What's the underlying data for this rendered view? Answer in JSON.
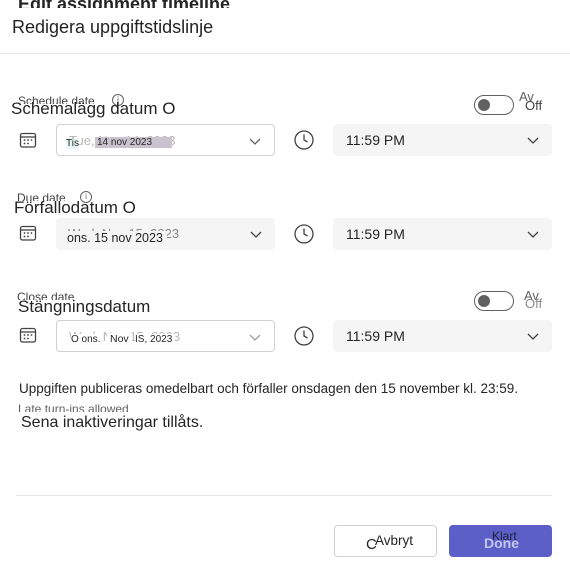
{
  "dialog": {
    "title": "Redigera uppgiftstidslinje",
    "title_ghost": "Edit assignment timeline"
  },
  "schedule": {
    "label": "Schemalägg datum O",
    "label_ghost": "Schedule date",
    "toggle_on_label": "Av",
    "toggle_off_label": "Off",
    "date_ghost": "Tue, Nov 14, 2023",
    "date_day": "Tis",
    "date_value": "14 nov 2023",
    "time": "11:59 PM"
  },
  "due": {
    "label": "Förfallodatum O",
    "label_ghost": "Due date",
    "date_ghost": "Wed, Nov 15, 2023",
    "date_value": "ons. 15 nov 2023",
    "time": "11:59 PM"
  },
  "close": {
    "label": "Stängningsdatum",
    "label_ghost": "Close date",
    "toggle_on_label": "Av",
    "toggle_off_label": "Off",
    "date_ghost": "Wed, Nov 15, 2023",
    "date_part1": "O ons.",
    "date_part2": "Nov",
    "date_part3": "IS, 2023",
    "time": "11:59 PM"
  },
  "summary": {
    "text": "Uppgiften publiceras omedelbart och förfaller onsdagen den 15 november kl. 23:59.",
    "ghost": "Late turn-ins allowed",
    "late_note": "Sena inaktiveringar tillåts."
  },
  "buttons": {
    "cancel_prefix": "C",
    "cancel_label": "Avbryt",
    "done_ghost": "Done",
    "done_label": "Klart"
  },
  "colors": {
    "accent": "#5b5fc7",
    "field_bg": "#f5f5f5",
    "border": "#d1d1d1"
  }
}
